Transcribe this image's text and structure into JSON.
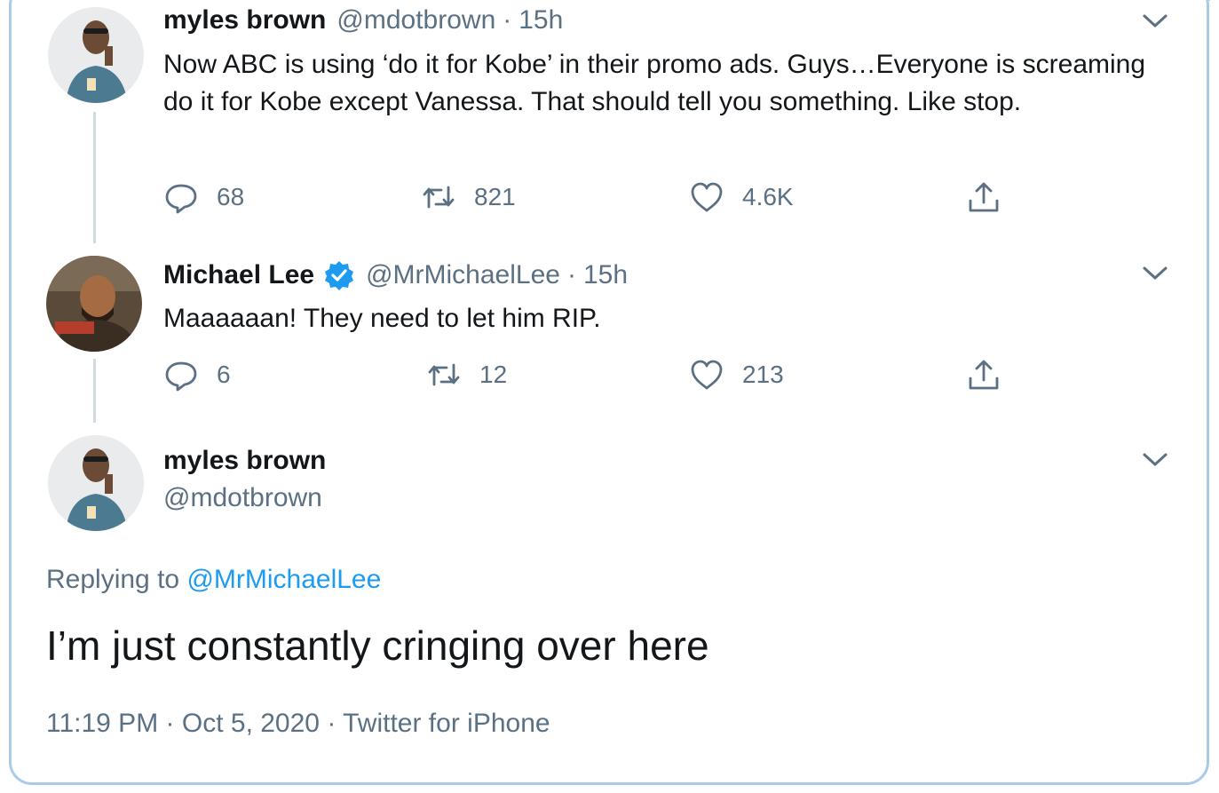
{
  "tweets": [
    {
      "name": "myles brown",
      "handle": "@mdotbrown",
      "separator": "·",
      "time": "15h",
      "text": "Now ABC is using ‘do it for Kobe’ in their promo ads. Guys…Everyone is screaming do it for Kobe except Vanessa. That should tell you something. Like stop.",
      "replies": "68",
      "retweets": "821",
      "likes": "4.6K"
    },
    {
      "name": "Michael Lee",
      "verified": true,
      "handle": "@MrMichaelLee",
      "separator": "·",
      "time": "15h",
      "text": "Maaaaaan! They need to let him RIP.",
      "replies": "6",
      "retweets": "12",
      "likes": "213"
    }
  ],
  "main_tweet": {
    "name": "myles brown",
    "handle": "@mdotbrown",
    "replying_label": "Replying to",
    "replying_handle": "@MrMichaelLee",
    "text": "I’m just constantly cringing over here",
    "time": "11:19 PM",
    "separator": "·",
    "date": "Oct 5, 2020",
    "source": "Twitter for iPhone"
  },
  "colors": {
    "accent": "#1d9bf0",
    "muted": "#5b7083",
    "text": "#14171a",
    "frame": "#a9cbea"
  },
  "icons": [
    "reply-icon",
    "retweet-icon",
    "like-icon",
    "share-icon",
    "chevron-down-icon",
    "verified-badge-icon"
  ]
}
